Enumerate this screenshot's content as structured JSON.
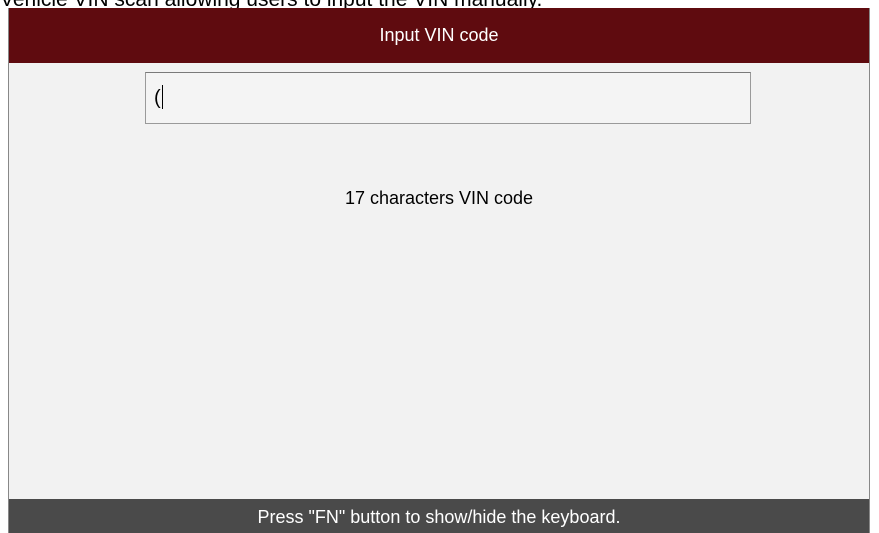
{
  "caption": "Vehicle VIN scan allowing users to input the VIN manually.",
  "header": {
    "title": "Input VIN code"
  },
  "vin_field": {
    "value": "("
  },
  "main": {
    "hint": "17 characters VIN code"
  },
  "footer": {
    "status": "Press \"FN\" button to show/hide the keyboard."
  },
  "colors": {
    "titlebar": "#5f0b0f",
    "statusbar": "#4a4a4a",
    "background": "#f2f2f2"
  }
}
